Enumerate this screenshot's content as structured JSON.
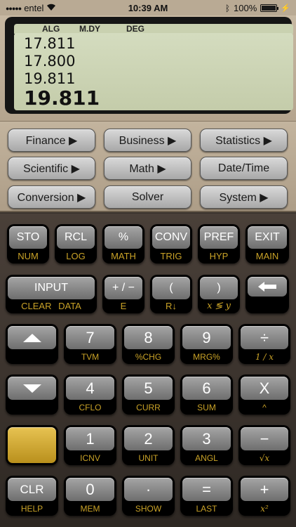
{
  "status_bar": {
    "carrier": "entel",
    "time": "10:39 AM",
    "battery": "100%",
    "battery_level": 1.0
  },
  "display": {
    "annunciators": [
      "ALG",
      "M.DY",
      "DEG"
    ],
    "lines": [
      "17.811",
      "17.800",
      "19.811"
    ],
    "main": "19.811"
  },
  "menus": [
    {
      "label": "Finance ▶"
    },
    {
      "label": "Business ▶"
    },
    {
      "label": "Statistics ▶"
    },
    {
      "label": "Scientific ▶"
    },
    {
      "label": "Math ▶"
    },
    {
      "label": "Date/Time"
    },
    {
      "label": "Conversion ▶"
    },
    {
      "label": "Solver"
    },
    {
      "label": "System ▶"
    }
  ],
  "keys": {
    "row1": [
      {
        "main": "STO",
        "sub": "NUM"
      },
      {
        "main": "RCL",
        "sub": "LOG"
      },
      {
        "main": "%",
        "sub": "MATH"
      },
      {
        "main": "CONV",
        "sub": "TRIG"
      },
      {
        "main": "PREF",
        "sub": "HYP"
      },
      {
        "main": "EXIT",
        "sub": "MAIN"
      }
    ],
    "row2": [
      {
        "main": "INPUT",
        "sub": "CLEAR  DATA"
      },
      {
        "main": "+ / −",
        "sub": "E"
      },
      {
        "main": "(",
        "sub": "R↓"
      },
      {
        "main": ")",
        "sub": "x ≶ y"
      },
      {
        "main": "←",
        "sub": ""
      }
    ],
    "row3": [
      {
        "main": "▲",
        "sub": ""
      },
      {
        "main": "7",
        "sub": "TVM"
      },
      {
        "main": "8",
        "sub": "%CHG"
      },
      {
        "main": "9",
        "sub": "MRG%"
      },
      {
        "main": "÷",
        "sub": "1 / x"
      }
    ],
    "row4": [
      {
        "main": "▼",
        "sub": ""
      },
      {
        "main": "4",
        "sub": "CFLO"
      },
      {
        "main": "5",
        "sub": "CURR"
      },
      {
        "main": "6",
        "sub": "SUM"
      },
      {
        "main": "X",
        "sub": "^"
      }
    ],
    "row5": [
      {
        "main": "",
        "sub": ""
      },
      {
        "main": "1",
        "sub": "ICNV"
      },
      {
        "main": "2",
        "sub": "UNIT"
      },
      {
        "main": "3",
        "sub": "ANGL"
      },
      {
        "main": "−",
        "sub": "√x"
      }
    ],
    "row6": [
      {
        "main": "CLR",
        "sub": "HELP"
      },
      {
        "main": "0",
        "sub": "MEM"
      },
      {
        "main": "·",
        "sub": "SHOW"
      },
      {
        "main": "=",
        "sub": "LAST"
      },
      {
        "main": "+",
        "sub": "x²"
      }
    ]
  },
  "icons": {
    "wifi": "wifi-icon",
    "bluetooth": "bluetooth-icon",
    "battery": "battery-icon",
    "backspace": "backspace-arrow-icon",
    "up": "up-arrow-icon",
    "down": "down-arrow-icon"
  },
  "colors": {
    "shift_key": "#d4a92a",
    "sub_label": "#c9a227",
    "lcd": "#c9d1b0"
  }
}
